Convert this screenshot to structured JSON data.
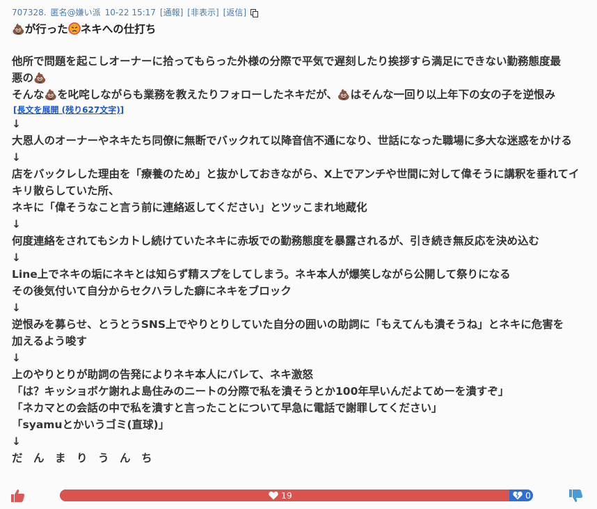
{
  "post": {
    "number": "707328.",
    "author": "匿名@嫌い派",
    "datetime": "10-22 15:17",
    "report": "[通報]",
    "hide": "[非表示]",
    "reply": "[返信]",
    "title_a": "が行った",
    "title_b": "ネキへの仕打ち"
  },
  "body": {
    "p1_line1": "他所で問題を起こしオーナーに拾ってもらった外様の分際で平気で遅刻したり挨拶すら満足にできない勤務態度最",
    "p1_line2": "悪の",
    "p2_a": "そんな",
    "p2_b": "を叱咤しながらも業務を教えたりフォローしたネキだが、",
    "p2_c": "はそんな一回り以上年下の女の子を逆恨み",
    "expand": "[長文を展開 (残り627文字)]",
    "arrow": "↓",
    "l1": "大恩人のオーナーやネキたち同僚に無断でバックれて以降音信不通になり、世話になった職場に多大な迷惑をかける",
    "l2": "店をバックレした理由を「療養のため」と抜かしておきながら、X上でアンチや世間に対して偉そうに講釈を垂れてイ",
    "l3": "キリ散らしていた所、",
    "l4": "ネキに「偉そうなこと言う前に連絡返してください」とツッこまれ地蔵化",
    "l5": "何度連絡をされてもシカトし続けていたネキに赤坂での勤務態度を暴露されるが、引き続き無反応を決め込む",
    "l6": "Line上でネキの垢にネキとは知らず精スプをしてしまう。ネキ本人が爆笑しながら公開して祭りになる",
    "l7": "その後気付いて自分からセクハラした癖にネキをブロック",
    "l8": "逆恨みを募らせ、とうとうSNS上でやりとりしていた自分の囲いの助詞に「もえてんも潰そうね」とネキに危害を",
    "l9": "加えるよう唆す",
    "l10": "上のやりとりが助詞の告発によりネキ本人にバレて、ネキ激怒",
    "l11": "「は？キッショボケ謝れよ島住みのニートの分際で私を潰そうとか100年早いんだよてめーを潰すぞ」",
    "l12": "「ネカマとの会話の中で私を潰すと言ったことについて早急に電話で謝罪してください」",
    "l13": "「syamuとかいうゴミ(直球)」",
    "l14": "だ　ん　ま　り　う　ん　ち"
  },
  "votes": {
    "good": "19",
    "bad": "0",
    "good_ratio": 0.95,
    "good_color": "#d9534f",
    "bad_color": "#2f6fd0",
    "icons": [
      "thumbs-up-icon",
      "heart-icon",
      "broken-heart-icon",
      "thumbs-down-icon",
      "poop-icon",
      "angry-face-icon",
      "copy-icon"
    ]
  }
}
